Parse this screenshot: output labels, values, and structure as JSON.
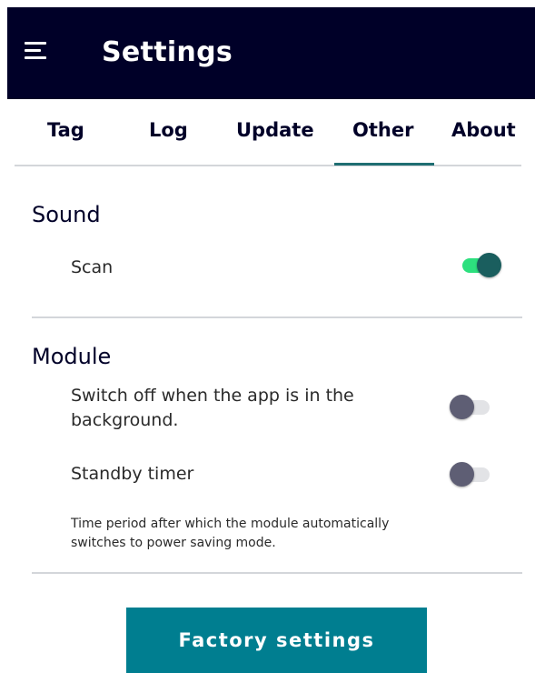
{
  "header": {
    "title": "Settings",
    "menu_icon": "hamburger-menu-icon"
  },
  "tabs": [
    {
      "label": "Tag"
    },
    {
      "label": "Log"
    },
    {
      "label": "Update"
    },
    {
      "label": "Other"
    },
    {
      "label": "About"
    }
  ],
  "active_tab": "Other",
  "sound": {
    "title": "Sound",
    "scan": {
      "label": "Scan",
      "enabled": true
    }
  },
  "module": {
    "title": "Module",
    "switch_off": {
      "label_line1": "Switch off when the app is in the",
      "label_line2": "background.",
      "enabled": false
    },
    "standby": {
      "label": "Standby timer",
      "enabled": false,
      "note_line1": "Time period after which the module automatically",
      "note_line2": "switches to power saving mode."
    }
  },
  "actions": {
    "factory_label": "Factory settings"
  },
  "colors": {
    "header_bg": "#000028",
    "accent_teal": "#007e90",
    "toggle_on_track": "#2de07e",
    "toggle_on_knob": "#1a5e5e",
    "toggle_off_knob": "#5e5e74"
  }
}
